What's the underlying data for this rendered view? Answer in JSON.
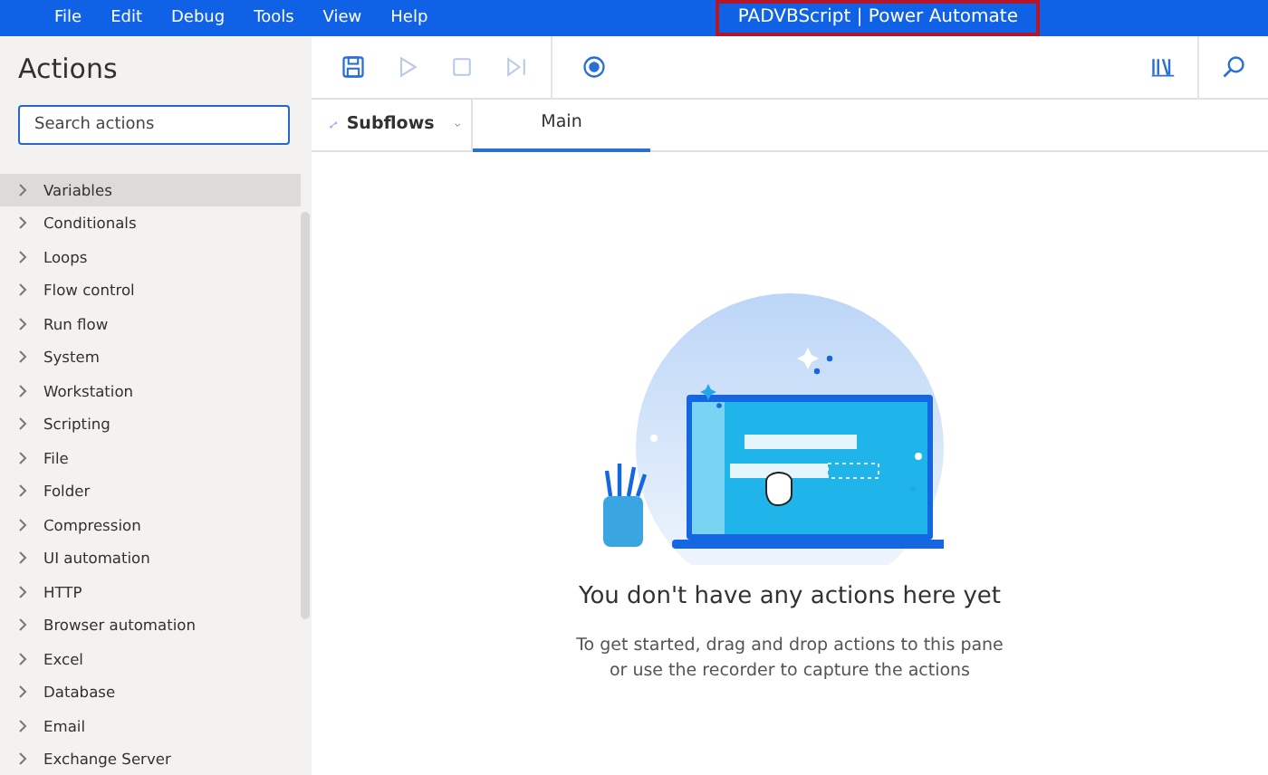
{
  "menu": [
    "File",
    "Edit",
    "Debug",
    "Tools",
    "View",
    "Help"
  ],
  "window": {
    "title": "PADVBScript | Power Automate"
  },
  "sidebar": {
    "title": "Actions",
    "search": {
      "placeholder": "Search actions"
    },
    "items": [
      {
        "label": "Variables",
        "selected": true
      },
      {
        "label": "Conditionals",
        "selected": false
      },
      {
        "label": "Loops",
        "selected": false
      },
      {
        "label": "Flow control",
        "selected": false
      },
      {
        "label": "Run flow",
        "selected": false
      },
      {
        "label": "System",
        "selected": false
      },
      {
        "label": "Workstation",
        "selected": false
      },
      {
        "label": "Scripting",
        "selected": false
      },
      {
        "label": "File",
        "selected": false
      },
      {
        "label": "Folder",
        "selected": false
      },
      {
        "label": "Compression",
        "selected": false
      },
      {
        "label": "UI automation",
        "selected": false
      },
      {
        "label": "HTTP",
        "selected": false
      },
      {
        "label": "Browser automation",
        "selected": false
      },
      {
        "label": "Excel",
        "selected": false
      },
      {
        "label": "Database",
        "selected": false
      },
      {
        "label": "Email",
        "selected": false
      },
      {
        "label": "Exchange Server",
        "selected": false
      }
    ]
  },
  "toolbar": [
    {
      "kind": "save",
      "disabled": false
    },
    {
      "kind": "run",
      "disabled": true
    },
    {
      "kind": "stop",
      "disabled": true
    },
    {
      "kind": "step",
      "disabled": true
    },
    {
      "kind": "record",
      "disabled": false
    }
  ],
  "subflows": {
    "label": "Subflows"
  },
  "tabs": [
    {
      "label": "Main",
      "selected": true
    }
  ],
  "empty_state": {
    "heading": "You don't have any actions here yet",
    "lines": [
      "To get started, drag and drop actions to this pane",
      "or use the recorder to capture the actions"
    ]
  }
}
